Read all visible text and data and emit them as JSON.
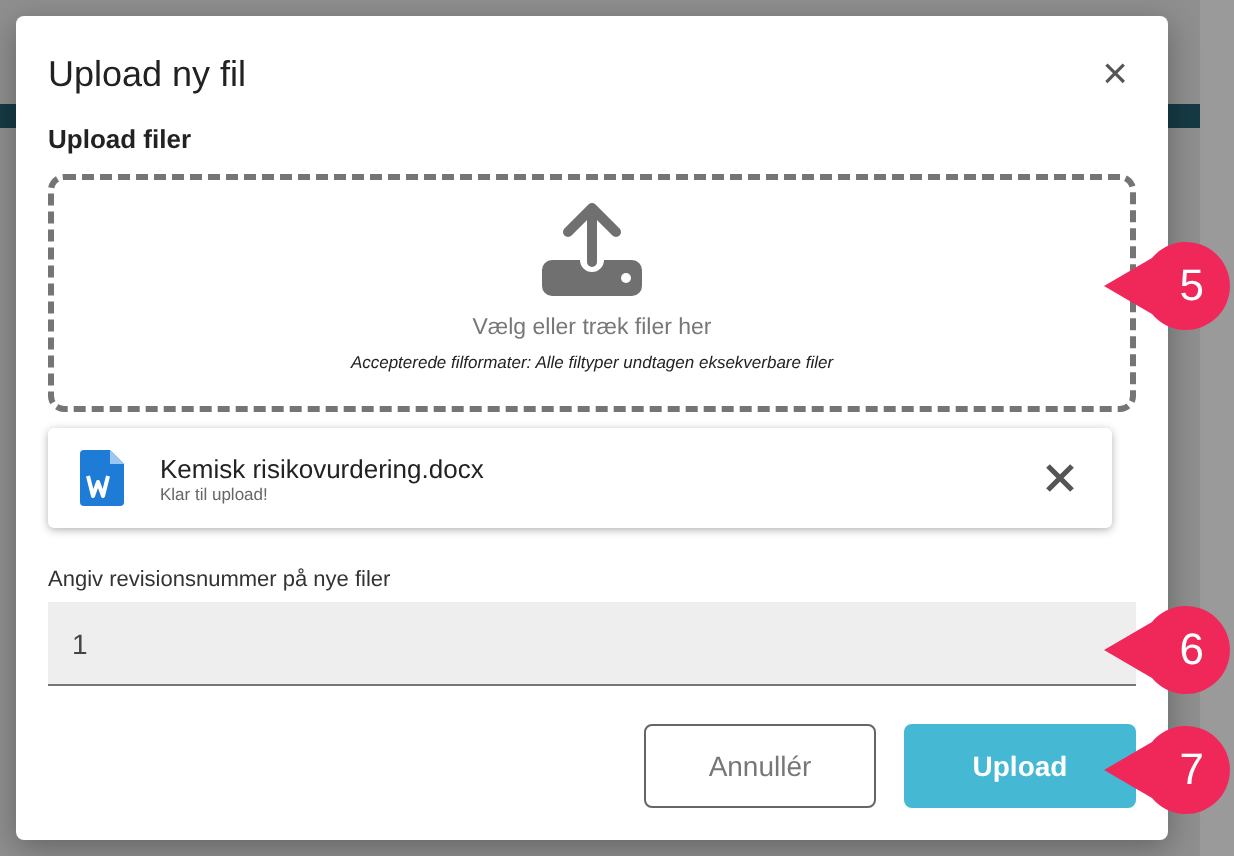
{
  "dialog": {
    "title": "Upload ny fil",
    "close": "×",
    "section_label": "Upload filer",
    "dropzone": {
      "prompt": "Vælg eller træk filer her",
      "hint": "Accepterede filformater: Alle filtyper undtagen eksekverbare filer"
    },
    "file": {
      "name": "Kemisk risikovurdering.docx",
      "status": "Klar til upload!"
    },
    "revision": {
      "label": "Angiv revisionsnummer på nye filer",
      "value": "1"
    },
    "buttons": [
      {
        "label": "Annullér",
        "kind": "secondary"
      },
      {
        "label": "Upload",
        "kind": "primary"
      }
    ]
  },
  "callouts": [
    {
      "label": "5"
    },
    {
      "label": "6"
    },
    {
      "label": "7"
    }
  ]
}
